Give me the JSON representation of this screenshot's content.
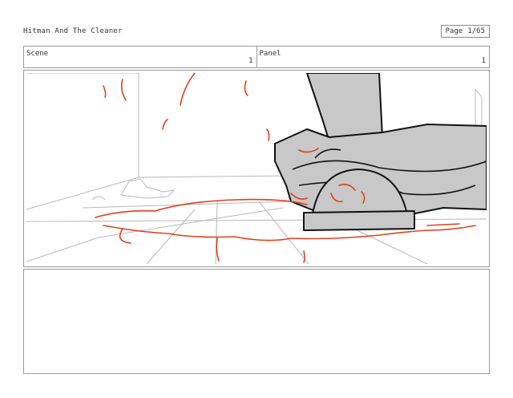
{
  "document": {
    "title": "Hitman And The Cleaner",
    "page_label": "Page",
    "page_value": "1/65"
  },
  "meta": {
    "scene_label": "Scene",
    "scene_value": "1",
    "panel_label": "Panel",
    "panel_value": "1"
  },
  "panel": {
    "image_subject": "storyboard-sketch-boot-in-blood",
    "colors": {
      "ink": "#111111",
      "blood": "#e0401c",
      "floor": "#b8b8b8",
      "fill": "#c8c8c8"
    }
  },
  "notes": {
    "text": ""
  }
}
